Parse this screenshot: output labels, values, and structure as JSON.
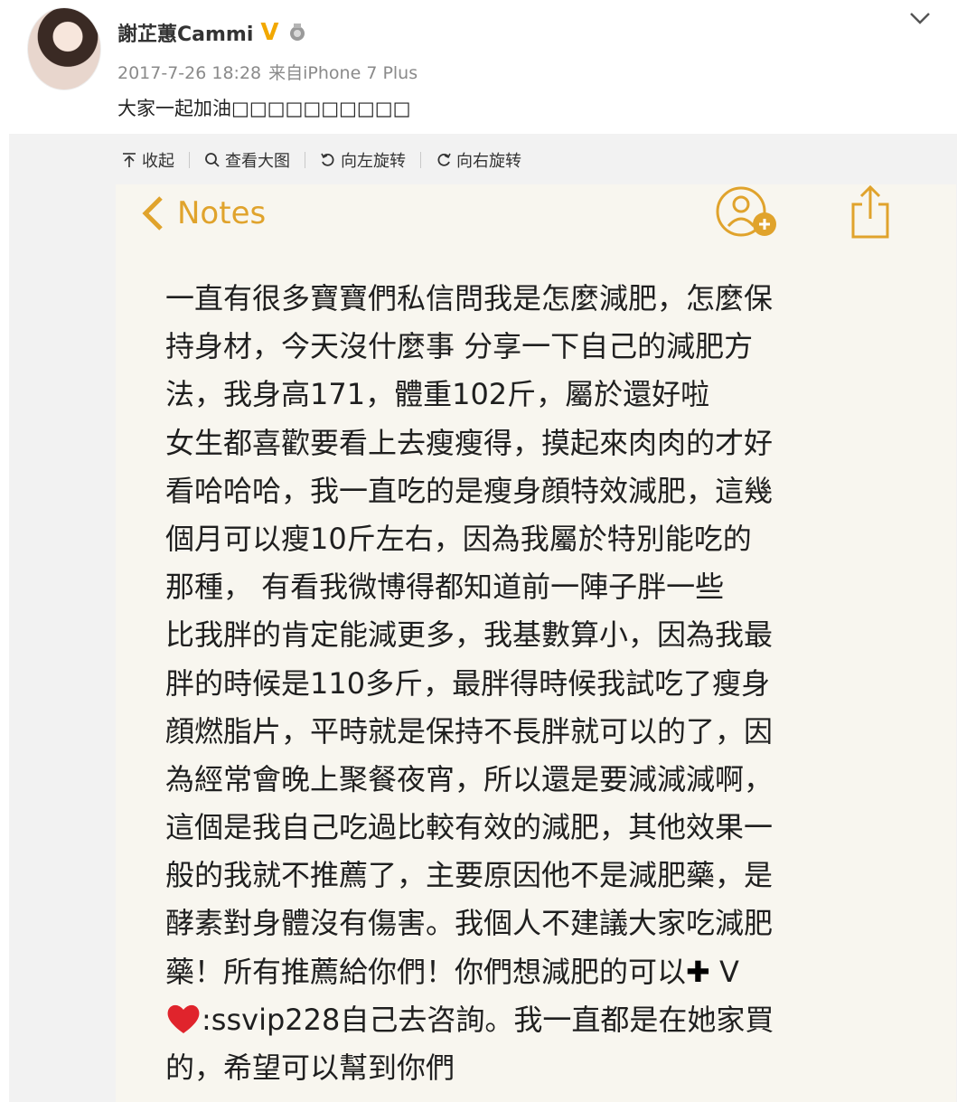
{
  "post": {
    "username": "謝芷蕙Cammi",
    "verified_mark": "V",
    "timestamp": "2017-7-26 18:28",
    "source_prefix": "来自",
    "source_device": "iPhone 7 Plus",
    "text": "大家一起加油□□□□□□□□□□"
  },
  "toolbar": {
    "collapse_label": "收起",
    "view_large_label": "查看大图",
    "rotate_left_label": "向左旋转",
    "rotate_right_label": "向右旋转"
  },
  "notes_app": {
    "back_label": "Notes",
    "accent_color": "#e0a32c",
    "lines": [
      "一直有很多寶寶們私信問我是怎麼減肥，怎麼保",
      "持身材，今天沒什麼事  分享一下自己的減肥方",
      "法，我身高171，體重102斤，屬於還好啦",
      "女生都喜歡要看上去瘦瘦得，摸起來肉肉的才好",
      "看哈哈哈，我一直吃的是瘦身顔特效減肥，這幾",
      "個月可以瘦10斤左右，因為我屬於特別能吃的",
      "那種，  有看我微博得都知道前一陣子胖一些",
      "比我胖的肯定能減更多，我基數算小，因為我最",
      "胖的時候是110多斤，最胖得時候我試吃了瘦身",
      "顔燃脂片，平時就是保持不長胖就可以的了，因",
      "為經常會晚上聚餐夜宵，所以還是要減減減啊，",
      "這個是我自己吃過比較有效的減肥，其他效果一",
      "般的我就不推薦了，主要原因他不是減肥藥，是",
      "酵素對身體沒有傷害。我個人不建議大家吃減肥",
      "藥！所有推薦給你們！你們想減肥的可以",
      "",
      "的，希望可以幫到你們"
    ],
    "line15_plus": "✚",
    "line15_suffix": " V",
    "line16_text": ":ssvip228自己去咨詢。我一直都是在她家買"
  }
}
